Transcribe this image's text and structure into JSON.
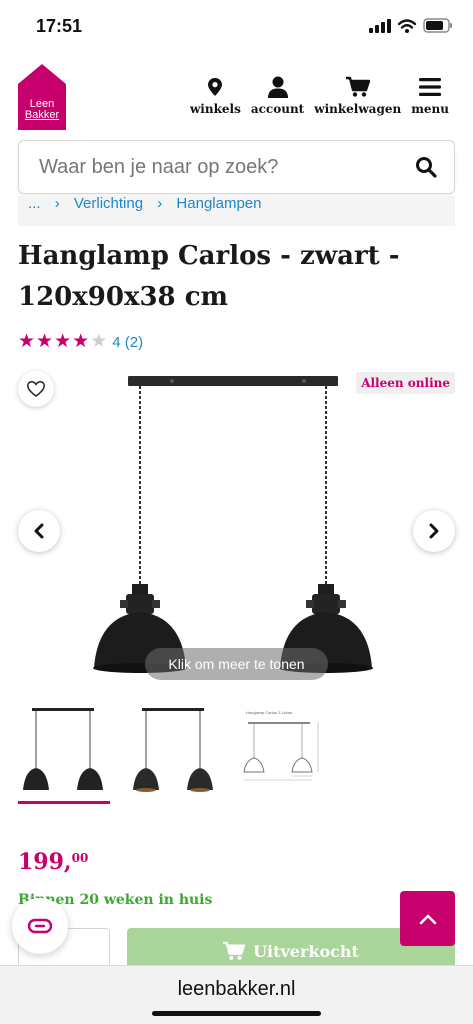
{
  "status_bar": {
    "time": "17:51"
  },
  "header": {
    "logo": {
      "line1": "Leen",
      "line2": "Bakker",
      "color": "#c8006e"
    },
    "nav": [
      {
        "label": "winkels",
        "icon": "location-pin-icon"
      },
      {
        "label": "account",
        "icon": "user-icon"
      },
      {
        "label": "winkelwagen",
        "icon": "cart-icon"
      },
      {
        "label": "menu",
        "icon": "hamburger-icon"
      }
    ]
  },
  "search": {
    "placeholder": "Waar ben je naar op zoek?"
  },
  "breadcrumb": {
    "items": [
      "...",
      "Verlichting",
      "Hanglampen"
    ]
  },
  "product": {
    "title_line1": "Hanglamp Carlos - zwart -",
    "title_line2": "120x90x38 cm",
    "rating": {
      "stars": 4,
      "max": 5,
      "text": "4 (2)"
    },
    "badge": "Alleen online",
    "more_label": "Klik om meer te tonen",
    "thumbnail_caption": "Hanglamp Carlos 2-Lichts",
    "price": {
      "main": "199,",
      "cents": "00"
    },
    "delivery": "Binnen 20 weken in huis",
    "sold_out_label": "Uitverkocht"
  },
  "colors": {
    "brand": "#c8006e",
    "link": "#1f86c9",
    "delivery": "#3fa833",
    "sold_out": "#a9d49a"
  },
  "browser": {
    "url": "leenbakker.nl"
  }
}
